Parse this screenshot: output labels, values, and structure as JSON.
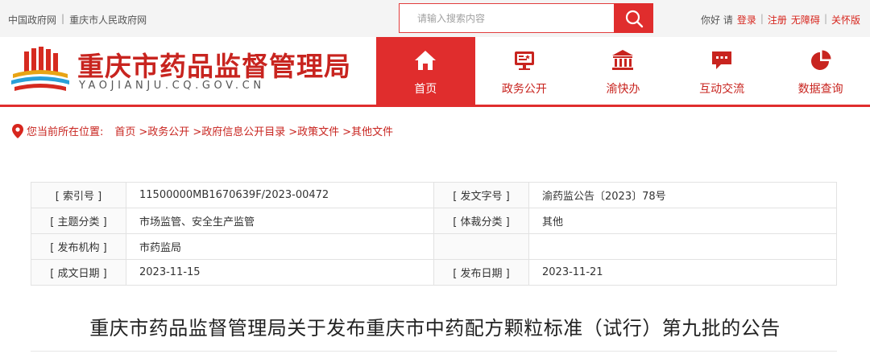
{
  "topbar": {
    "links": [
      "中国政府网",
      "重庆市人民政府网"
    ],
    "search_placeholder": "请输入搜索内容",
    "greeting": "你好 请",
    "login": "登录",
    "register": "注册",
    "accessibility": "无障碍",
    "elderly": "关怀版"
  },
  "header": {
    "site_title": "重庆市药品监督管理局",
    "domain": "YAOJIANJU.CQ.GOV.CN"
  },
  "nav": [
    {
      "label": "首页",
      "icon": "home-icon",
      "active": true
    },
    {
      "label": "政务公开",
      "icon": "monitor-icon",
      "active": false
    },
    {
      "label": "渝快办",
      "icon": "bank-icon",
      "active": false
    },
    {
      "label": "互动交流",
      "icon": "chat-icon",
      "active": false
    },
    {
      "label": "数据查询",
      "icon": "pie-chart-icon",
      "active": false
    }
  ],
  "breadcrumb": {
    "label": "您当前所在位置:",
    "items": [
      "首页",
      ">政务公开",
      ">政府信息公开目录",
      ">政策文件",
      ">其他文件"
    ]
  },
  "info": {
    "rows": [
      {
        "k1": "[ 索引号 ]",
        "v1": "11500000MB1670639F/2023-00472",
        "k2": "[ 发文字号 ]",
        "v2": "渝药监公告〔2023〕78号"
      },
      {
        "k1": "[ 主题分类 ]",
        "v1": "市场监管、安全生产监管",
        "k2": "[ 体裁分类 ]",
        "v2": "其他"
      },
      {
        "k1": "[ 发布机构 ]",
        "v1": "市药监局",
        "k2": "",
        "v2": ""
      },
      {
        "k1": "[ 成文日期 ]",
        "v1": "2023-11-15",
        "k2": "[ 发布日期 ]",
        "v2": "2023-11-21"
      }
    ]
  },
  "article": {
    "title": "重庆市药品监督管理局关于发布重庆市中药配方颗粒标准（试行）第九批的公告"
  },
  "colors": {
    "brand_red": "#e02d2d",
    "title_red": "#c8241f"
  }
}
